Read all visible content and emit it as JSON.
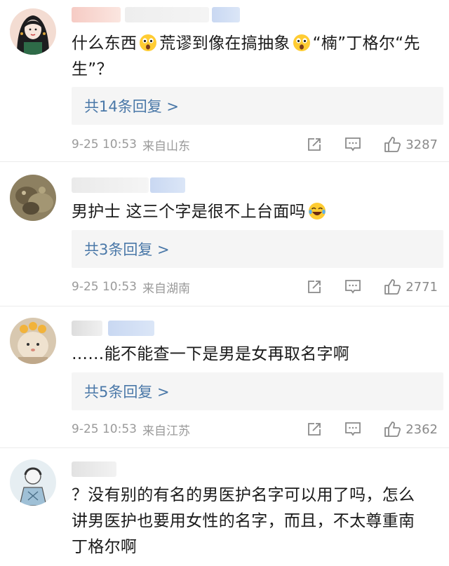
{
  "comments": [
    {
      "text_parts": [
        "什么东西",
        "荒谬到像在搞抽象",
        "“楠”丁格尔“先生”？"
      ],
      "reply_label": "共14条回复 >",
      "time": "9-25 10:53",
      "location": "来自山东",
      "likes": "3287"
    },
    {
      "text_parts": [
        "男护士 这三个字是很不上台面吗"
      ],
      "reply_label": "共3条回复 >",
      "time": "9-25 10:53",
      "location": "来自湖南",
      "likes": "2771"
    },
    {
      "text_parts": [
        "……能不能查一下是男是女再取名字啊"
      ],
      "reply_label": "共5条回复 >",
      "time": "9-25 10:53",
      "location": "来自江苏",
      "likes": "2362"
    },
    {
      "text_parts": [
        "？没有别的有名的男医护名字可以用了吗，怎么讲男医护也要用女性的名字，而且，不太尊重南丁格尔啊"
      ]
    }
  ],
  "icons": {
    "share": "share-icon",
    "comment": "comment-icon",
    "like": "thumbs-up-icon",
    "emoji_shock": "shocked-face-emoji",
    "emoji_laugh": "tears-of-joy-emoji"
  },
  "colors": {
    "link": "#4a78a8",
    "meta": "#9a9a9a",
    "reply_bg": "#f5f5f5"
  }
}
